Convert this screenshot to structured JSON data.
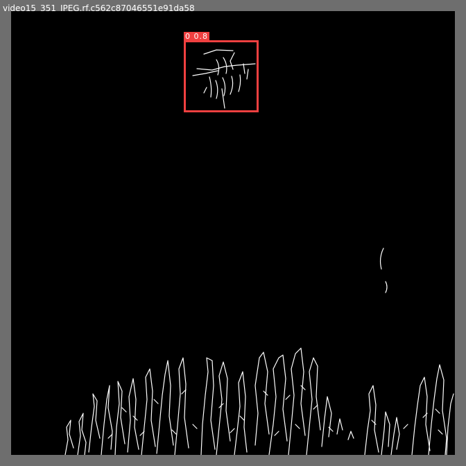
{
  "window": {
    "title": "video15_351_JPEG.rf.c562c87046551e91da58"
  },
  "detection": {
    "label": "0 0.8",
    "box_color": "#f04040",
    "object_icon": "drone-icon"
  },
  "image": {
    "background_color": "#000000",
    "edge_color": "#ffffff",
    "frame_color": "#6e6e6e"
  }
}
